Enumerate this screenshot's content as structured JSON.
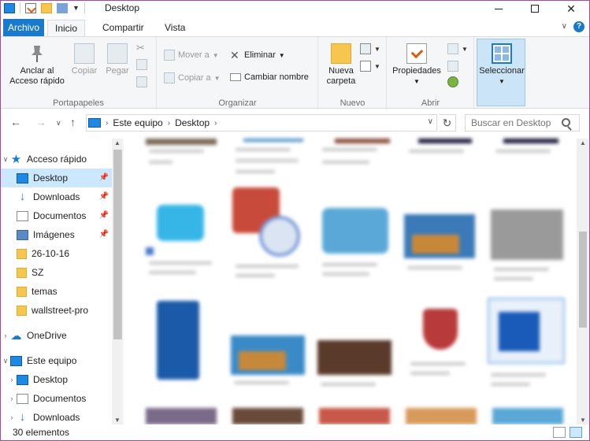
{
  "window": {
    "title": "Desktop"
  },
  "tabs": [
    {
      "label": "Archivo"
    },
    {
      "label": "Inicio"
    },
    {
      "label": "Compartir"
    },
    {
      "label": "Vista"
    }
  ],
  "ribbon": {
    "portapapeles": {
      "label": "Portapapeles",
      "pin_line1": "Anclar al",
      "pin_line2": "Acceso rápido",
      "copy": "Copiar",
      "paste": "Pegar"
    },
    "organizar": {
      "label": "Organizar",
      "move": "Mover a",
      "copyto": "Copiar a",
      "delete": "Eliminar",
      "rename": "Cambiar nombre"
    },
    "nuevo": {
      "label": "Nuevo",
      "newfolder_line1": "Nueva",
      "newfolder_line2": "carpeta"
    },
    "abrir": {
      "label": "Abrir",
      "properties": "Propiedades"
    },
    "seleccionar": {
      "label": "Seleccionar"
    }
  },
  "address": {
    "crumbs": [
      "Este equipo",
      "Desktop"
    ]
  },
  "search": {
    "placeholder": "Buscar en Desktop"
  },
  "nav": {
    "quick_access": "Acceso rápido",
    "items": [
      {
        "label": "Desktop",
        "icon": "desktop-icon",
        "pinned": true
      },
      {
        "label": "Downloads",
        "icon": "download-icon",
        "pinned": true
      },
      {
        "label": "Documentos",
        "icon": "document-icon",
        "pinned": true
      },
      {
        "label": "Imágenes",
        "icon": "image-icon",
        "pinned": true
      },
      {
        "label": "26-10-16",
        "icon": "folder-icon",
        "pinned": false
      },
      {
        "label": "SZ",
        "icon": "folder-icon",
        "pinned": false
      },
      {
        "label": "temas",
        "icon": "folder-icon",
        "pinned": false
      },
      {
        "label": "wallstreet-pro",
        "icon": "folder-icon",
        "pinned": false
      }
    ],
    "onedrive": "OneDrive",
    "this_pc": "Este equipo",
    "pc_items": [
      {
        "label": "Desktop",
        "icon": "desktop-icon"
      },
      {
        "label": "Documentos",
        "icon": "document-icon"
      },
      {
        "label": "Downloads",
        "icon": "download-icon"
      }
    ]
  },
  "status": {
    "count": "30 elementos"
  },
  "colors": {
    "accent": "#1979ca",
    "selection": "#cce8ff",
    "ribbon_bg": "#f5f6f7",
    "window_border": "#a34aa0"
  }
}
